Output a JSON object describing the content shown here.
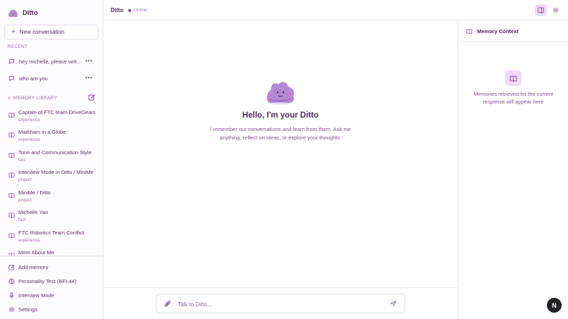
{
  "brand": {
    "name": "Ditto"
  },
  "sidebar": {
    "new_conversation": "New conversation",
    "recent_label": "RECENT",
    "recent": [
      {
        "label": "hey michelle, please write a..."
      },
      {
        "label": "who are you"
      }
    ],
    "library_label": "MEMORY LIBRARY",
    "memories": [
      {
        "title": "Captain of FTC team DriveGears",
        "type": "experience"
      },
      {
        "title": "Markham in a Globe",
        "type": "experience"
      },
      {
        "title": "Tone and Communication Style",
        "type": "fact"
      },
      {
        "title": "Interview Mode in Ditto / MiniMe",
        "type": "project"
      },
      {
        "title": "MiniMe / Ditto",
        "type": "project"
      },
      {
        "title": "Michelle Yao",
        "type": "fact"
      },
      {
        "title": "FTC Robotics Team Conflict",
        "type": "experience"
      },
      {
        "title": "More About Me",
        "type": ""
      }
    ],
    "bottom": {
      "add_memory": "Add memory",
      "personality_test": "Personality Test (BFI-44)",
      "interview_mode": "Interview Mode",
      "settings": "Settings"
    }
  },
  "header": {
    "title": "Ditto",
    "status": "Online"
  },
  "main": {
    "title": "Hello, I'm your Ditto",
    "subtitle": "I remember our conversations and learn from them. Ask me anything, reflect on ideas, or explore your thoughts."
  },
  "composer": {
    "placeholder": "Talk to Ditto..."
  },
  "right_panel": {
    "title": "Memory Context",
    "empty_text": "Memories retrieved for the current response will appear here"
  },
  "fab": {
    "label": "N"
  },
  "colors": {
    "accent": "#7b3f99",
    "accent_soft": "#eedbf5",
    "text": "#4a2a55",
    "muted": "#8a6f96"
  }
}
